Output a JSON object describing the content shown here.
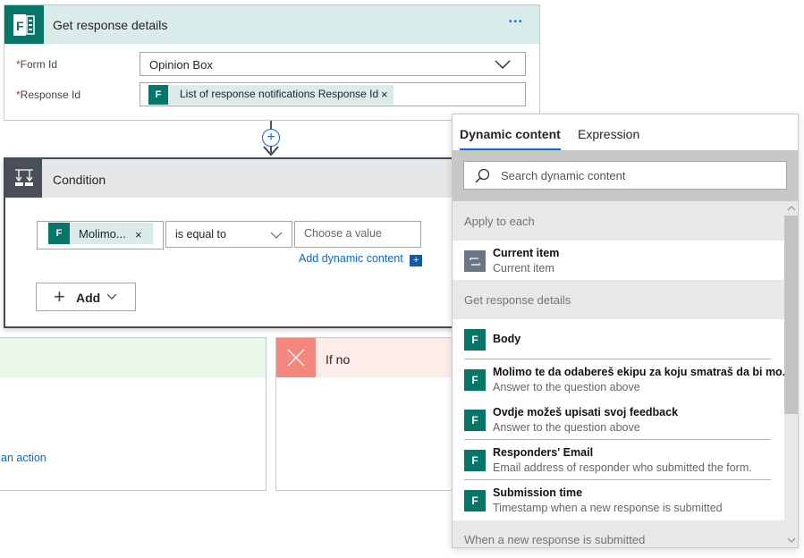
{
  "get_response": {
    "title": "Get response details",
    "more": "•••",
    "form_id_label": "Form Id",
    "form_id_value": "Opinion Box",
    "response_id_label": "Response Id",
    "response_id_token": "List of response notifications Response Id",
    "required_mark": "*",
    "remove": "×"
  },
  "condition": {
    "title": "Condition",
    "token": "Molimo...",
    "remove": "×",
    "operator": "is equal to",
    "value_placeholder": "Choose a value",
    "add_dynamic": "Add dynamic content",
    "add_button": "Add"
  },
  "branches": {
    "yes_link": "an action",
    "no_title": "If no"
  },
  "panel": {
    "tabs": [
      {
        "label": "Dynamic content",
        "active": true
      },
      {
        "label": "Expression",
        "active": false
      }
    ],
    "search_placeholder": "Search dynamic content",
    "sections": [
      {
        "header": "Apply to each",
        "items": [
          {
            "title": "Current item",
            "subtitle": "Current item",
            "icon": "loop-icon"
          }
        ]
      },
      {
        "header": "Get response details",
        "items": [
          {
            "title": "Body",
            "subtitle": "",
            "icon": "forms-icon"
          },
          {
            "title": "Molimo te da odabereš ekipu za koju smatraš da bi mo...",
            "subtitle": "Answer to the question above",
            "icon": "forms-icon"
          },
          {
            "title": "Ovdje možeš upisati svoj feedback",
            "subtitle": "Answer to the question above",
            "icon": "forms-icon"
          },
          {
            "title": "Responders' Email",
            "subtitle": "Email address of responder who submitted the form.",
            "icon": "forms-icon"
          },
          {
            "title": "Submission time",
            "subtitle": "Timestamp when a new response is submitted",
            "icon": "forms-icon"
          }
        ]
      },
      {
        "header": "When a new response is submitted",
        "items": []
      }
    ]
  },
  "colors": {
    "forms_teal": "#077568",
    "accent_blue": "#0a69d6",
    "no_red": "#f6877f"
  }
}
